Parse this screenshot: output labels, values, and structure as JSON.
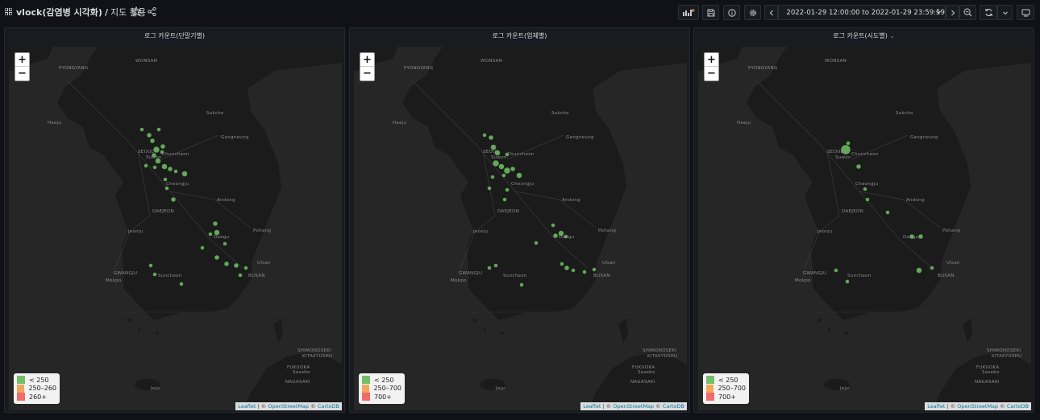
{
  "header": {
    "folder": "vlock(감염병 시각화)",
    "separator": "/",
    "title": "지도 활용",
    "icons": [
      "apps-icon",
      "star-icon",
      "share-icon"
    ]
  },
  "toolbar": {
    "buttons": [
      "add-panel-icon",
      "save-icon",
      "info-icon",
      "gear-icon"
    ],
    "time_range": "2022-01-29 12:00:00 to 2022-01-29 23:59:59",
    "nav_icons": [
      "chevron-left-icon",
      "clock-icon",
      "chevron-down-icon",
      "chevron-right-icon",
      "zoom-out-icon",
      "refresh-icon",
      "chevron-down-icon",
      "tv-icon"
    ]
  },
  "map_labels": {
    "cities": [
      "WONSAN",
      "PYONGYANG",
      "Haeju",
      "Sokcho",
      "SEOUL",
      "Suwon",
      "Chuncheon",
      "Gangneung",
      "Cheongju",
      "DAEJEON",
      "Andong",
      "Jeonju",
      "Daegu",
      "Pohang",
      "GWANGJU",
      "BUSAN",
      "Ulsan",
      "Suncheon",
      "Mokpo",
      "Jeju",
      "Sasebo",
      "NAGASAKI",
      "SHIMONOSEKI",
      "KITAKYUSHU",
      "FUKUOKA"
    ],
    "zoom_in": "+",
    "zoom_out": "−",
    "attribution": {
      "leaflet": "Leaflet",
      "sep1": " | © ",
      "osm": "OpenStreetMap",
      "sep2": " © ",
      "carto": "CartoDB"
    }
  },
  "panels": [
    {
      "title": "로그 카운트(단말기별)",
      "legend": [
        {
          "label": "< 250",
          "color": "#73bf69"
        },
        {
          "label": "250–260",
          "color": "#f2a65a"
        },
        {
          "label": "260+",
          "color": "#f06b6b"
        }
      ],
      "has_menu": false
    },
    {
      "title": "로그 카운트(업체별)",
      "legend": [
        {
          "label": "< 250",
          "color": "#73bf69"
        },
        {
          "label": "250–700",
          "color": "#f2a65a"
        },
        {
          "label": "700+",
          "color": "#f06b6b"
        }
      ],
      "has_menu": false
    },
    {
      "title": "로그 카운트(시도별)",
      "legend": [
        {
          "label": "< 250",
          "color": "#73bf69"
        },
        {
          "label": "250–700",
          "color": "#f2a65a"
        },
        {
          "label": "700+",
          "color": "#f06b6b"
        }
      ],
      "has_menu": true,
      "menu_caret": "⌄"
    }
  ],
  "colors": {
    "marker": "#73bf69",
    "land": "#1a1a1a",
    "sea": "#262626",
    "roads": "#3a3a3a"
  }
}
